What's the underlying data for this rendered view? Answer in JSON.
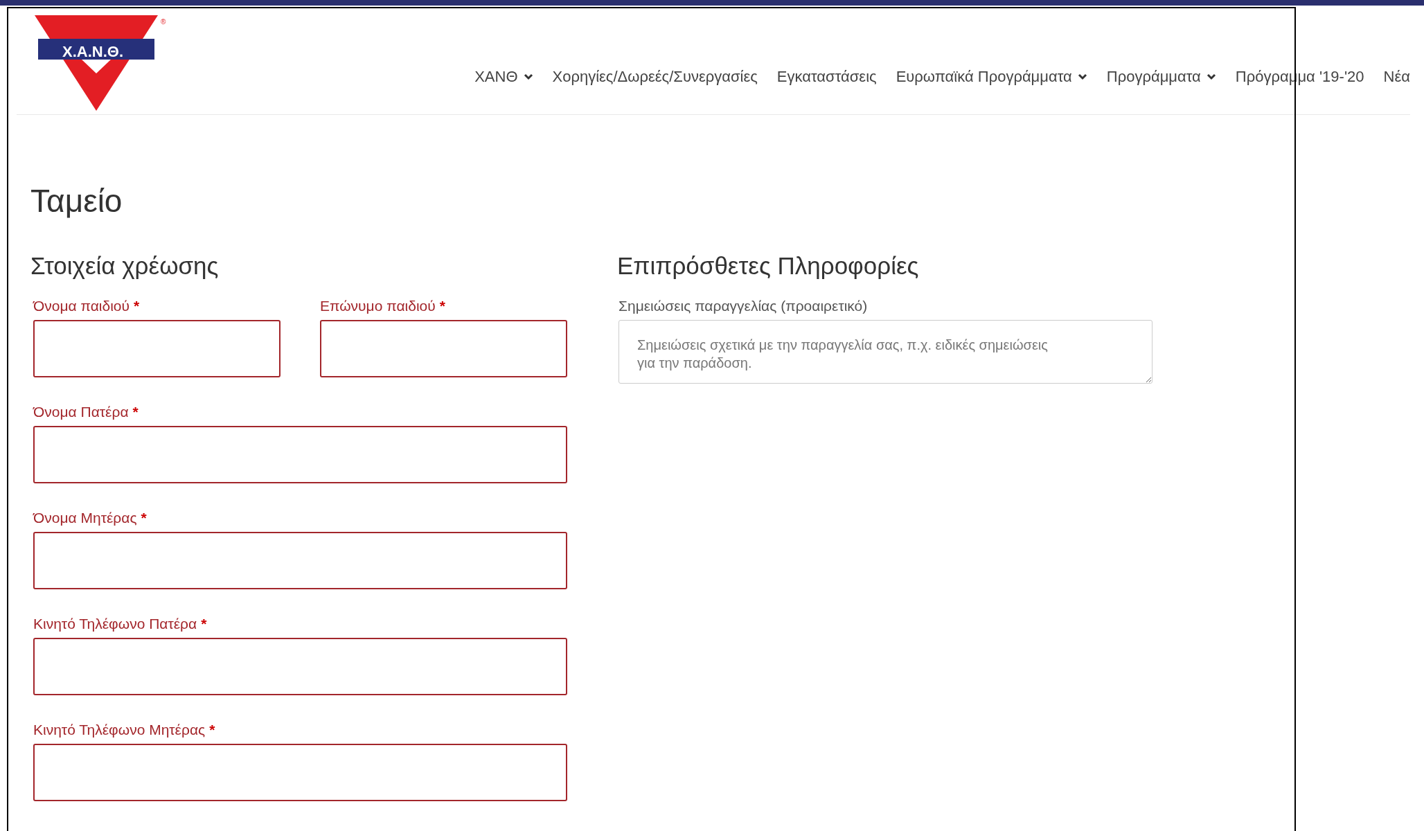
{
  "logo": {
    "text": "Χ.Α.Ν.Θ.",
    "registered": "®"
  },
  "nav": [
    {
      "label": "ΧΑΝΘ",
      "dropdown": true
    },
    {
      "label": "Χορηγίες/Δωρεές/Συνεργασίες",
      "dropdown": false
    },
    {
      "label": "Εγκαταστάσεις",
      "dropdown": false
    },
    {
      "label": "Ευρωπαϊκά Προγράμματα",
      "dropdown": true
    },
    {
      "label": "Προγράμματα",
      "dropdown": true
    },
    {
      "label": "Πρόγραμμα '19-'20",
      "dropdown": false
    },
    {
      "label": "Νέα",
      "dropdown": false
    }
  ],
  "page_title": "Ταμείο",
  "required_marker": "*",
  "billing": {
    "title": "Στοιχεία χρέωσης",
    "fields": [
      {
        "label": "Όνομα παιδιού",
        "required": true,
        "kind": "half"
      },
      {
        "label": "Επώνυμο παιδιού",
        "required": true,
        "kind": "half"
      },
      {
        "label": "Όνομα Πατέρα",
        "required": true,
        "kind": "full"
      },
      {
        "label": "Όνομα Μητέρας",
        "required": true,
        "kind": "full"
      },
      {
        "label": "Κινητό Τηλέφωνο Πατέρα",
        "required": true,
        "kind": "full"
      },
      {
        "label": "Κινητό Τηλέφωνο Μητέρας",
        "required": true,
        "kind": "full"
      }
    ]
  },
  "additional": {
    "title": "Επιπρόσθετες Πληροφορίες",
    "notes": {
      "label": "Σημειώσεις παραγγελίας (προαιρετικό)",
      "placeholder": "Σημειώσεις σχετικά με την παραγγελία σας, π.χ. ειδικές σημειώσεις για την παράδοση."
    }
  }
}
